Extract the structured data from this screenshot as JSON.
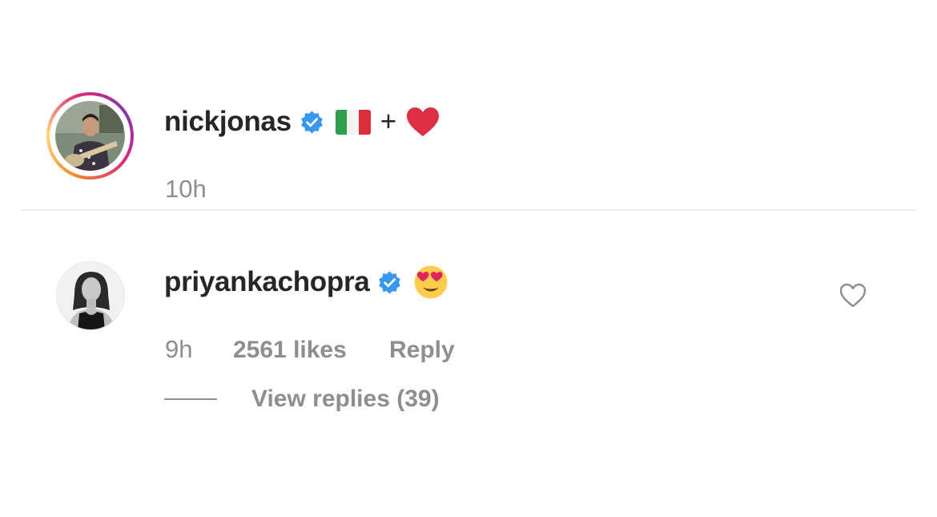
{
  "caption": {
    "username": "nickjonas",
    "verified": true,
    "text_parts": [
      "flag-italy",
      "+",
      "red-heart"
    ],
    "plus_text": "+",
    "timestamp": "10h"
  },
  "comment": {
    "username": "priyankachopra",
    "verified": true,
    "text_parts": [
      "smiling-face-with-heart-eyes"
    ],
    "timestamp": "9h",
    "likes": "2561 likes",
    "reply_label": "Reply",
    "view_replies_label": "View replies (39)"
  },
  "colors": {
    "text_primary": "#262626",
    "text_secondary": "#8e8e8e",
    "verified_blue": "#3897f0",
    "divider": "#ececec"
  },
  "icons": {
    "verified": "verified-badge-icon",
    "like": "heart-outline-icon"
  }
}
